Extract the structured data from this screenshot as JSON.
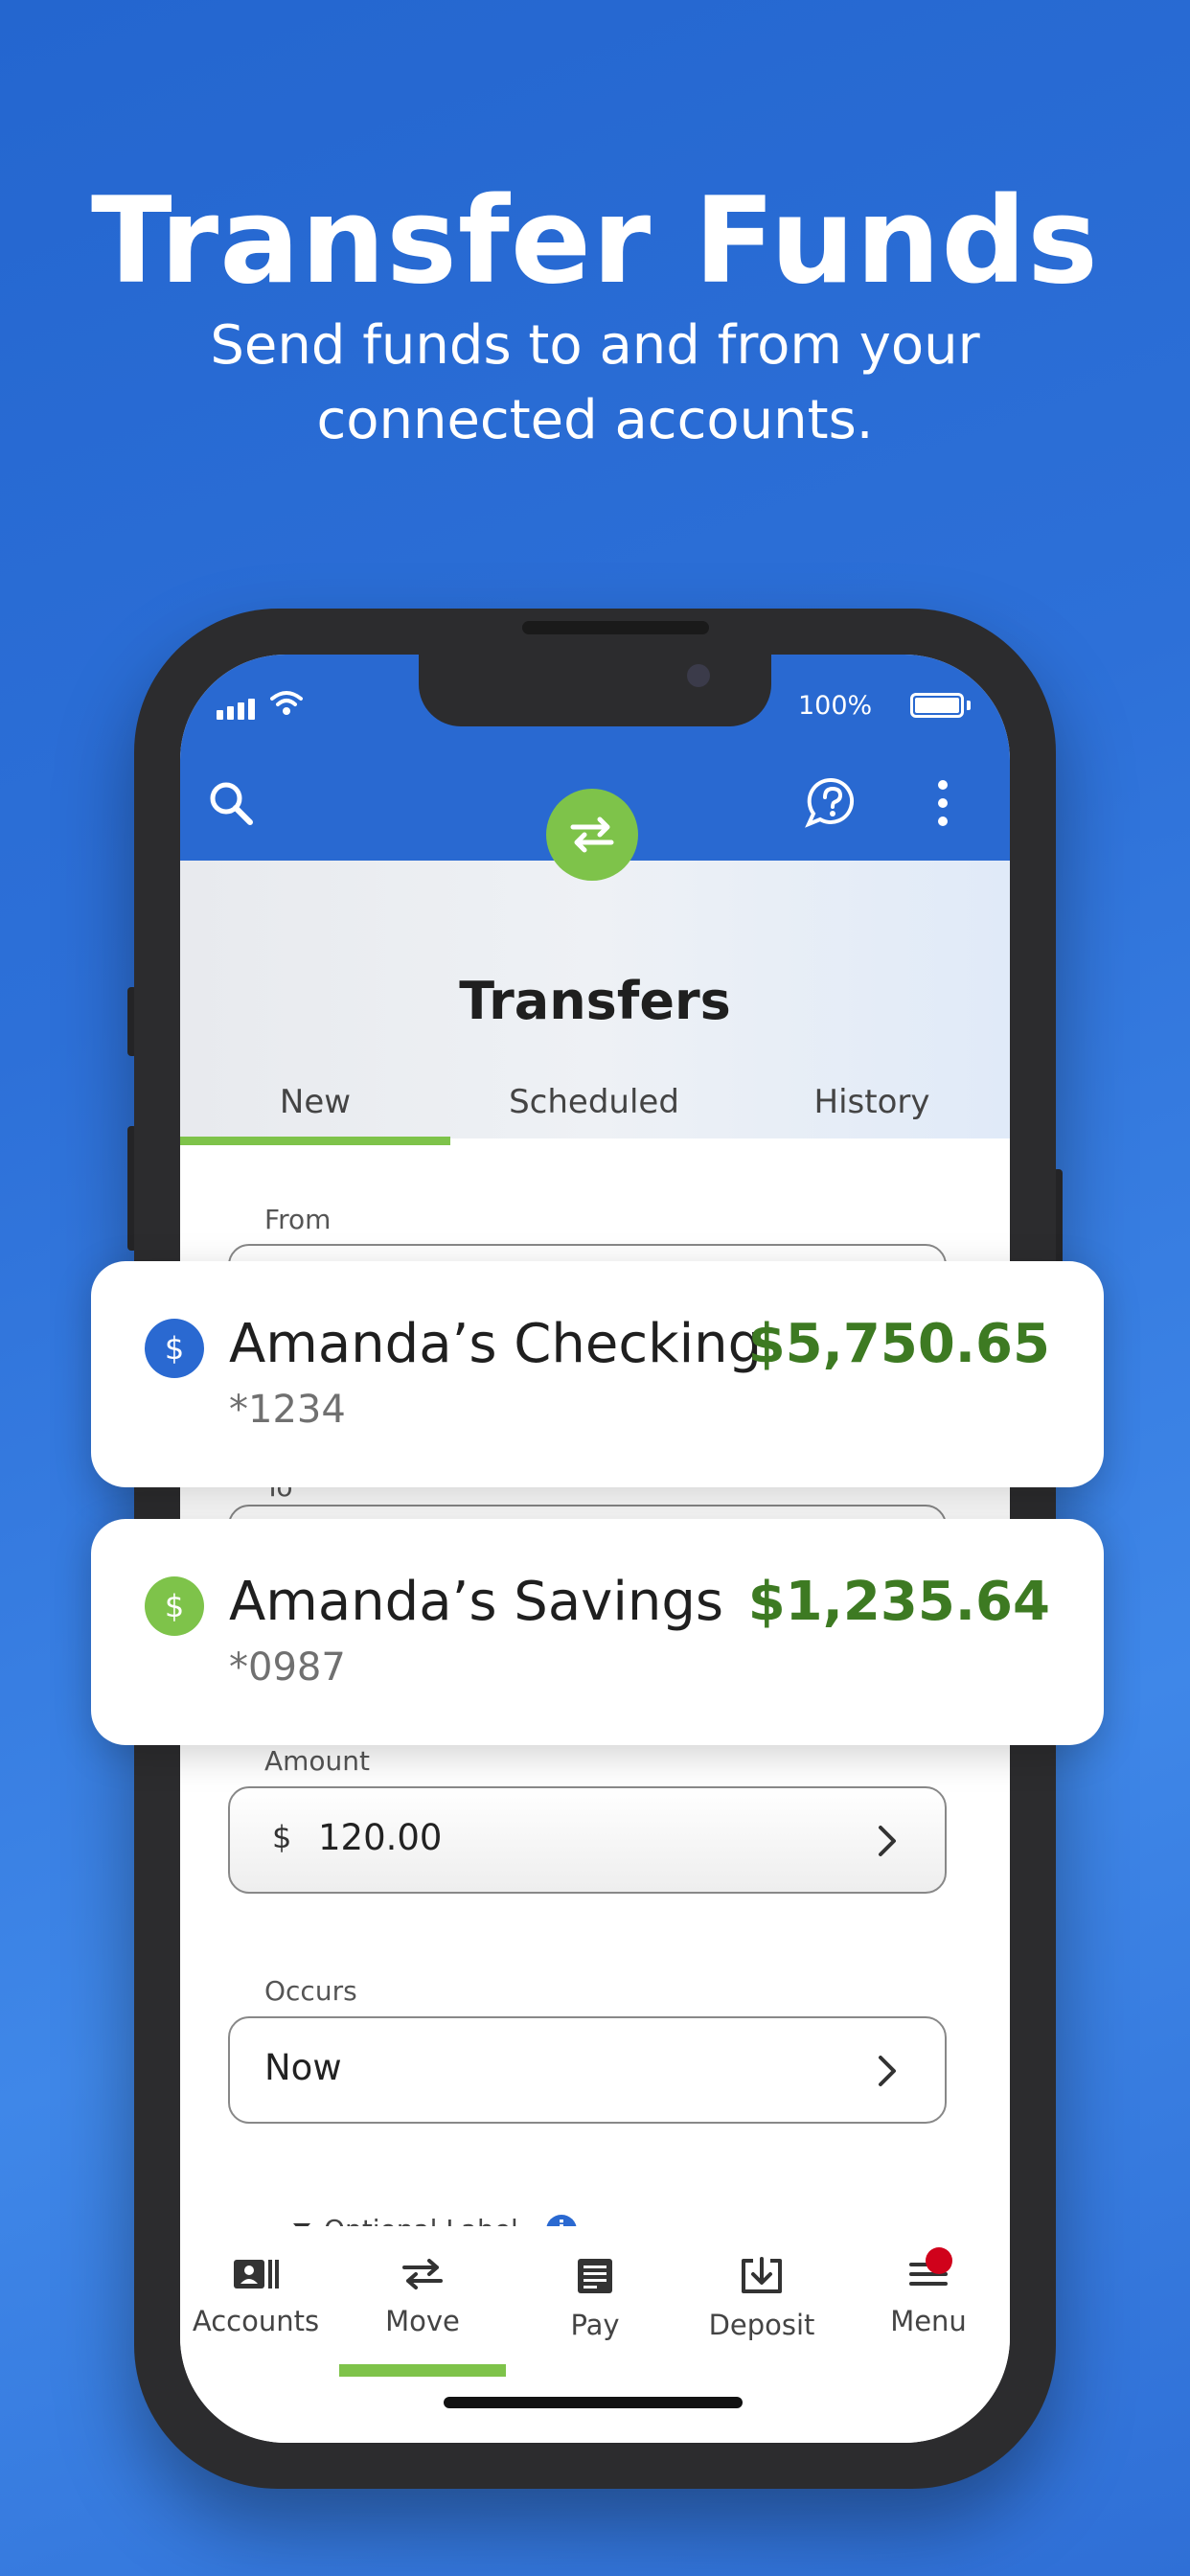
{
  "hero": {
    "title": "Transfer Funds",
    "subtitle_line1": "Send funds to and from your",
    "subtitle_line2": "connected accounts."
  },
  "status_bar": {
    "battery_text": "100%"
  },
  "header": {
    "title": "Transfers"
  },
  "tabs": [
    {
      "label": "New",
      "active": true
    },
    {
      "label": "Scheduled",
      "active": false
    },
    {
      "label": "History",
      "active": false
    }
  ],
  "form": {
    "from_label": "From",
    "to_label": "To",
    "amount_label": "Amount",
    "amount_currency": "$",
    "amount_value": "120.00",
    "occurs_label": "Occurs",
    "occurs_value": "Now",
    "optional_label": "Optional Label"
  },
  "accounts": [
    {
      "name": "Amanda’s Checking",
      "number": "*1234",
      "balance": "$5,750.65",
      "icon_color": "#2a69d1"
    },
    {
      "name": "Amanda’s Savings",
      "number": "*0987",
      "balance": "$1,235.64",
      "icon_color": "#7ec34a"
    }
  ],
  "nav": [
    {
      "label": "Accounts"
    },
    {
      "label": "Move",
      "active": true
    },
    {
      "label": "Pay"
    },
    {
      "label": "Deposit"
    },
    {
      "label": "Menu",
      "badge": true
    }
  ],
  "colors": {
    "brand_blue": "#2969d1",
    "accent_green": "#7ec34a",
    "balance_green": "#3d7a22",
    "badge_red": "#d0021b"
  }
}
